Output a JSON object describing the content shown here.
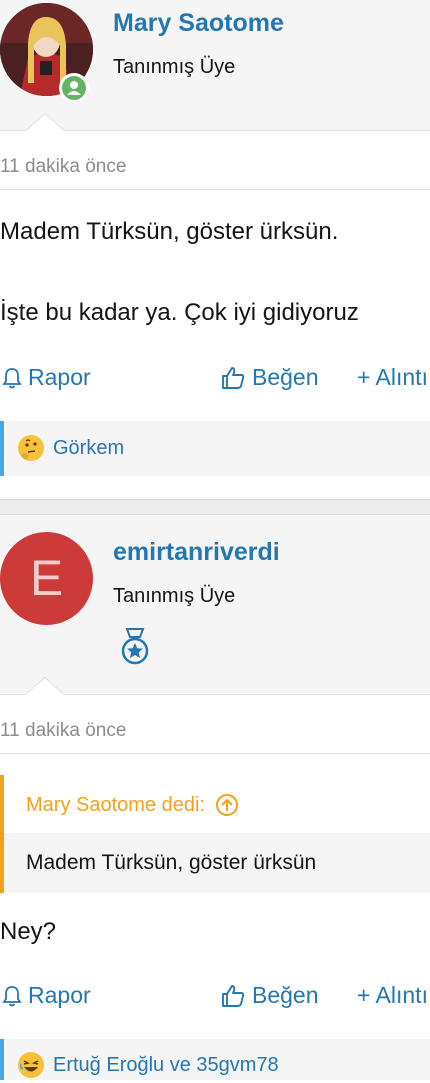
{
  "posts": [
    {
      "user": {
        "name": "Mary Saotome",
        "title": "Tanınmış Üye",
        "status_color": "#63b265"
      },
      "timestamp": "11 dakika önce",
      "body": [
        "Madem Türksün, göster ürksün.",
        "İşte bu kadar ya. Çok iyi gidiyoruz"
      ],
      "actions": {
        "report": "Rapor",
        "like": "Beğen",
        "quote": "+ Alıntı"
      },
      "reactions": {
        "emoji": "thinking-face",
        "text": "Görkem"
      }
    },
    {
      "user": {
        "name": "emirtanriverdi",
        "title": "Tanınmış Üye",
        "avatar_letter": "E",
        "avatar_color": "#cc3a3a",
        "badge_icon": "medal-icon"
      },
      "timestamp": "11 dakika önce",
      "quote": {
        "title": "Mary Saotome dedi:",
        "text": "Madem Türksün, göster ürksün"
      },
      "body": [
        "Ney?"
      ],
      "actions": {
        "report": "Rapor",
        "like": "Beğen",
        "quote": "+ Alıntı"
      },
      "reactions": {
        "emoji": "laughing-face",
        "text": "Ertuğ Eroğlu ve 35gvm78"
      }
    }
  ],
  "colors": {
    "link": "#2577b1",
    "accent_blue": "#47a7eb",
    "quote_orange": "#f3a11b"
  }
}
